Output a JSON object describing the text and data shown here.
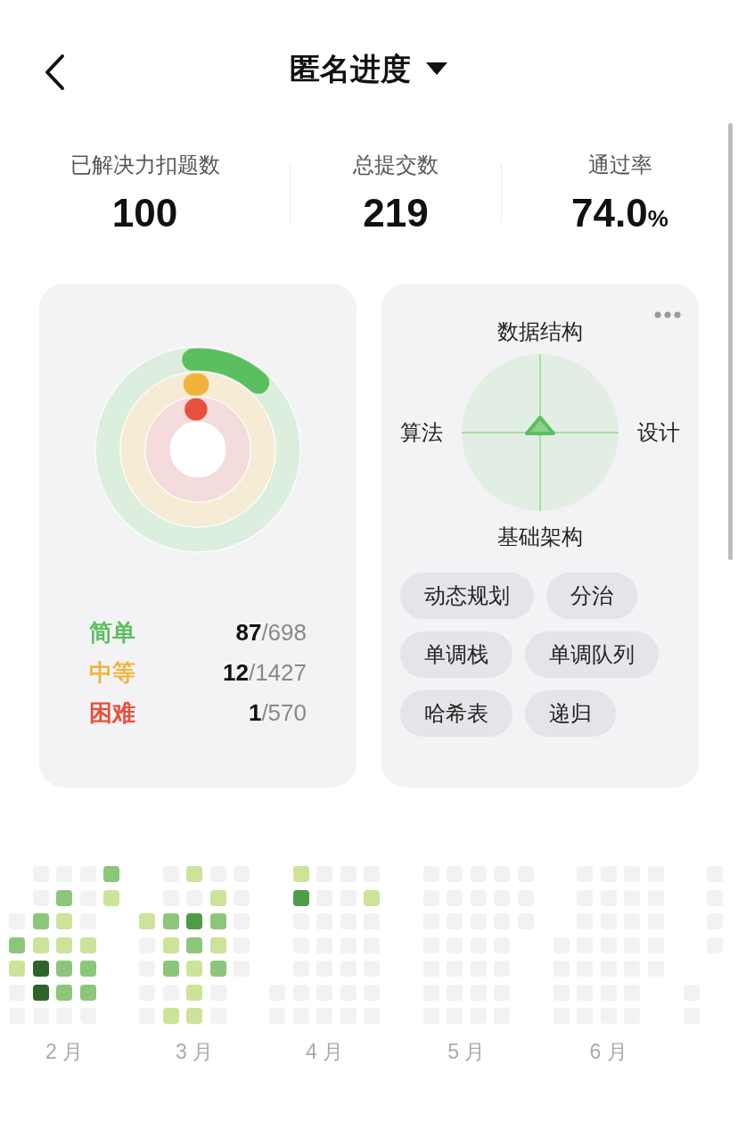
{
  "header": {
    "title": "匿名进度"
  },
  "stats": [
    {
      "label": "已解决力扣题数",
      "value": "100"
    },
    {
      "label": "总提交数",
      "value": "219"
    },
    {
      "label": "通过率",
      "value": "74.0",
      "unit": "%"
    }
  ],
  "difficulty": [
    {
      "name": "简单",
      "solved": "87",
      "total": "/698",
      "level": 0.125,
      "color": "#5cbf5f"
    },
    {
      "name": "中等",
      "solved": "12",
      "total": "/1427",
      "level": 0.0084,
      "color": "#f0b43c"
    },
    {
      "name": "困难",
      "solved": "1",
      "total": "/570",
      "level": 0.0018,
      "color": "#e8503c"
    }
  ],
  "skills": {
    "axes": {
      "top": "数据结构",
      "left": "算法",
      "right": "设计",
      "bottom": "基础架构"
    },
    "tags": [
      "动态规划",
      "分治",
      "单调栈",
      "单调队列",
      "哈希表",
      "递归"
    ]
  },
  "heatmap": [
    {
      "month": "2 月",
      "columns": [
        [
          null,
          null,
          {
            "color": "#f2f2f4"
          },
          {
            "color": "#8cc67b"
          },
          {
            "color": "#cde39a"
          },
          {
            "color": "#f2f2f4"
          },
          {
            "color": "#f2f2f4"
          }
        ],
        [
          {
            "color": "#f2f2f4"
          },
          {
            "color": "#f2f2f4"
          },
          {
            "color": "#8cc67b"
          },
          {
            "color": "#cde39a"
          },
          {
            "color": "#2e6428"
          },
          {
            "color": "#2e6428"
          },
          {
            "color": "#f2f2f4"
          }
        ],
        [
          {
            "color": "#f2f2f4"
          },
          {
            "color": "#8cc67b"
          },
          {
            "color": "#cde39a"
          },
          {
            "color": "#cde39a"
          },
          {
            "color": "#8cc67b"
          },
          {
            "color": "#8cc67b"
          },
          {
            "color": "#f2f2f4"
          }
        ],
        [
          {
            "color": "#f2f2f4"
          },
          {
            "color": "#f2f2f4"
          },
          {
            "color": "#f2f2f4"
          },
          {
            "color": "#cde39a"
          },
          {
            "color": "#8cc67b"
          },
          {
            "color": "#8cc67b"
          },
          {
            "color": "#f2f2f4"
          }
        ],
        [
          {
            "color": "#8cc67b"
          },
          {
            "color": "#cde39a"
          },
          null,
          null,
          null,
          null,
          null
        ]
      ]
    },
    {
      "month": "3 月",
      "columns": [
        [
          null,
          null,
          {
            "color": "#cde39a"
          },
          {
            "color": "#f2f2f4"
          },
          {
            "color": "#f2f2f4"
          },
          {
            "color": "#f2f2f4"
          },
          {
            "color": "#f2f2f4"
          }
        ],
        [
          {
            "color": "#f2f2f4"
          },
          {
            "color": "#f2f2f4"
          },
          {
            "color": "#8cc67b"
          },
          {
            "color": "#cde39a"
          },
          {
            "color": "#8cc67b"
          },
          {
            "color": "#f2f2f4"
          },
          {
            "color": "#cde39a"
          }
        ],
        [
          {
            "color": "#cde39a"
          },
          {
            "color": "#f2f2f4"
          },
          {
            "color": "#4f9c48"
          },
          {
            "color": "#8cc67b"
          },
          {
            "color": "#cde39a"
          },
          {
            "color": "#cde39a"
          },
          {
            "color": "#cde39a"
          }
        ],
        [
          {
            "color": "#f2f2f4"
          },
          {
            "color": "#cde39a"
          },
          {
            "color": "#8cc67b"
          },
          {
            "color": "#cde39a"
          },
          {
            "color": "#8cc67b"
          },
          {
            "color": "#f2f2f4"
          },
          {
            "color": "#f2f2f4"
          }
        ],
        [
          {
            "color": "#f2f2f4"
          },
          {
            "color": "#f2f2f4"
          },
          {
            "color": "#f2f2f4"
          },
          {
            "color": "#f2f2f4"
          },
          {
            "color": "#f2f2f4"
          },
          null,
          null
        ]
      ]
    },
    {
      "month": "4 月",
      "columns": [
        [
          null,
          null,
          null,
          null,
          null,
          {
            "color": "#f2f2f4"
          },
          {
            "color": "#f2f2f4"
          }
        ],
        [
          {
            "color": "#cde39a"
          },
          {
            "color": "#4f9c48"
          },
          {
            "color": "#f2f2f4"
          },
          {
            "color": "#f2f2f4"
          },
          {
            "color": "#f2f2f4"
          },
          {
            "color": "#f2f2f4"
          },
          {
            "color": "#f2f2f4"
          }
        ],
        [
          {
            "color": "#f2f2f4"
          },
          {
            "color": "#f2f2f4"
          },
          {
            "color": "#f2f2f4"
          },
          {
            "color": "#f2f2f4"
          },
          {
            "color": "#f2f2f4"
          },
          {
            "color": "#f2f2f4"
          },
          {
            "color": "#f2f2f4"
          }
        ],
        [
          {
            "color": "#f2f2f4"
          },
          {
            "color": "#f2f2f4"
          },
          {
            "color": "#f2f2f4"
          },
          {
            "color": "#f2f2f4"
          },
          {
            "color": "#f2f2f4"
          },
          {
            "color": "#f2f2f4"
          },
          {
            "color": "#f2f2f4"
          }
        ],
        [
          {
            "color": "#f2f2f4"
          },
          {
            "color": "#cde39a"
          },
          {
            "color": "#f2f2f4"
          },
          {
            "color": "#f2f2f4"
          },
          {
            "color": "#f2f2f4"
          },
          {
            "color": "#f2f2f4"
          },
          {
            "color": "#f2f2f4"
          }
        ]
      ]
    },
    {
      "month": "5 月",
      "columns": [
        [
          null,
          null,
          null,
          null,
          null,
          null,
          null
        ],
        [
          {
            "color": "#f2f2f4"
          },
          {
            "color": "#f2f2f4"
          },
          {
            "color": "#f2f2f4"
          },
          {
            "color": "#f2f2f4"
          },
          {
            "color": "#f2f2f4"
          },
          {
            "color": "#f2f2f4"
          },
          {
            "color": "#f2f2f4"
          }
        ],
        [
          {
            "color": "#f2f2f4"
          },
          {
            "color": "#f2f2f4"
          },
          {
            "color": "#f2f2f4"
          },
          {
            "color": "#f2f2f4"
          },
          {
            "color": "#f2f2f4"
          },
          {
            "color": "#f2f2f4"
          },
          {
            "color": "#f2f2f4"
          }
        ],
        [
          {
            "color": "#f2f2f4"
          },
          {
            "color": "#f2f2f4"
          },
          {
            "color": "#f2f2f4"
          },
          {
            "color": "#f2f2f4"
          },
          {
            "color": "#f2f2f4"
          },
          {
            "color": "#f2f2f4"
          },
          {
            "color": "#f2f2f4"
          }
        ],
        [
          {
            "color": "#f2f2f4"
          },
          {
            "color": "#f2f2f4"
          },
          {
            "color": "#f2f2f4"
          },
          {
            "color": "#f2f2f4"
          },
          {
            "color": "#f2f2f4"
          },
          {
            "color": "#f2f2f4"
          },
          {
            "color": "#f2f2f4"
          }
        ],
        [
          {
            "color": "#f2f2f4"
          },
          {
            "color": "#f2f2f4"
          },
          {
            "color": "#f2f2f4"
          },
          null,
          null,
          null,
          null
        ]
      ]
    },
    {
      "month": "6 月",
      "columns": [
        [
          null,
          null,
          null,
          {
            "color": "#f2f2f4"
          },
          {
            "color": "#f2f2f4"
          },
          {
            "color": "#f2f2f4"
          },
          {
            "color": "#f2f2f4"
          }
        ],
        [
          {
            "color": "#f2f2f4"
          },
          {
            "color": "#f2f2f4"
          },
          {
            "color": "#f2f2f4"
          },
          {
            "color": "#f2f2f4"
          },
          {
            "color": "#f2f2f4"
          },
          {
            "color": "#f2f2f4"
          },
          {
            "color": "#f2f2f4"
          }
        ],
        [
          {
            "color": "#f2f2f4"
          },
          {
            "color": "#f2f2f4"
          },
          {
            "color": "#f2f2f4"
          },
          {
            "color": "#f2f2f4"
          },
          {
            "color": "#f2f2f4"
          },
          {
            "color": "#f2f2f4"
          },
          {
            "color": "#f2f2f4"
          }
        ],
        [
          {
            "color": "#f2f2f4"
          },
          {
            "color": "#f2f2f4"
          },
          {
            "color": "#f2f2f4"
          },
          {
            "color": "#f2f2f4"
          },
          {
            "color": "#f2f2f4"
          },
          {
            "color": "#f2f2f4"
          },
          {
            "color": "#f2f2f4"
          }
        ],
        [
          {
            "color": "#f2f2f4"
          },
          {
            "color": "#f2f2f4"
          },
          {
            "color": "#f2f2f4"
          },
          {
            "color": "#f2f2f4"
          },
          {
            "color": "#f2f2f4"
          },
          null,
          null
        ]
      ]
    },
    {
      "columns": [
        [
          null,
          null,
          null,
          null,
          null,
          {
            "color": "#f2f2f4"
          },
          {
            "color": "#f2f2f4"
          }
        ],
        [
          {
            "color": "#f2f2f4"
          },
          {
            "color": "#f2f2f4"
          },
          {
            "color": "#f2f2f4"
          },
          {
            "color": "#f2f2f4"
          },
          null,
          null,
          null
        ]
      ]
    }
  ]
}
